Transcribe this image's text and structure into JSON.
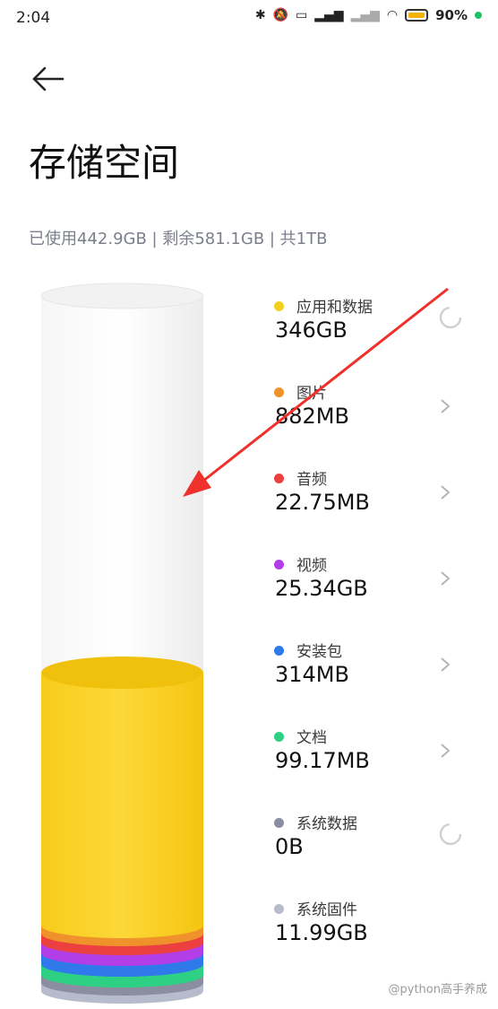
{
  "status_bar": {
    "time": "2:04",
    "battery_percent": "90%"
  },
  "page": {
    "title": "存储空间",
    "summary": "已使用442.9GB | 剩余581.1GB | 共1TB"
  },
  "categories": [
    {
      "label": "应用和数据",
      "size": "346GB",
      "color": "#f5cf1f",
      "action": "spinner"
    },
    {
      "label": "图片",
      "size": "882MB",
      "color": "#f0922b",
      "action": "chevron"
    },
    {
      "label": "音频",
      "size": "22.75MB",
      "color": "#ec4040",
      "action": "chevron"
    },
    {
      "label": "视频",
      "size": "25.34GB",
      "color": "#b13ee6",
      "action": "chevron"
    },
    {
      "label": "安装包",
      "size": "314MB",
      "color": "#2f79ea",
      "action": "chevron"
    },
    {
      "label": "文档",
      "size": "99.17MB",
      "color": "#2ed183",
      "action": "chevron"
    },
    {
      "label": "系统数据",
      "size": "0B",
      "color": "#8a8ea0",
      "action": "spinner"
    },
    {
      "label": "系统固件",
      "size": "11.99GB",
      "color": "#b7bccd",
      "action": "none"
    }
  ],
  "watermark": "@python高手养成",
  "annotation_arrow_color": "#f0302a"
}
